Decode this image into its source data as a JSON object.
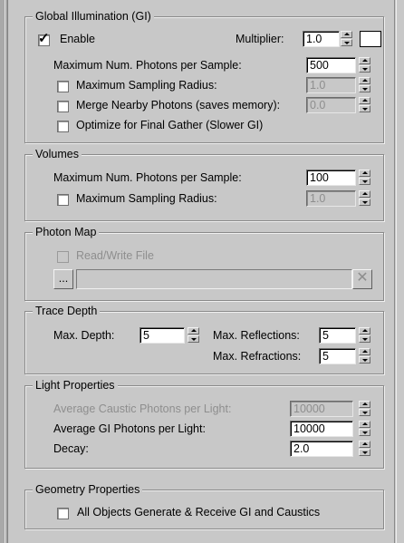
{
  "gi": {
    "title": "Global Illumination (GI)",
    "enable_label": "Enable",
    "enable_checked": true,
    "multiplier_label": "Multiplier:",
    "multiplier_value": "1.0",
    "multiplier_color": "#ffffff",
    "max_photons_label": "Maximum Num. Photons per Sample:",
    "max_photons_value": "500",
    "max_radius_label": "Maximum Sampling Radius:",
    "max_radius_value": "1.0",
    "merge_label": "Merge Nearby Photons (saves memory):",
    "merge_value": "0.0",
    "optimize_label": "Optimize for Final Gather (Slower GI)"
  },
  "volumes": {
    "title": "Volumes",
    "max_photons_label": "Maximum Num. Photons per Sample:",
    "max_photons_value": "100",
    "max_radius_label": "Maximum Sampling Radius:",
    "max_radius_value": "1.0"
  },
  "photon_map": {
    "title": "Photon Map",
    "rw_label": "Read/Write File",
    "browse_label": "...",
    "file_path": "",
    "clear_glyph": "✕"
  },
  "trace_depth": {
    "title": "Trace Depth",
    "max_depth_label": "Max. Depth:",
    "max_depth_value": "5",
    "reflections_label": "Max. Reflections:",
    "reflections_value": "5",
    "refractions_label": "Max. Refractions:",
    "refractions_value": "5"
  },
  "light": {
    "title": "Light Properties",
    "caustic_label": "Average Caustic Photons per Light:",
    "caustic_value": "10000",
    "gi_label": "Average GI Photons per Light:",
    "gi_value": "10000",
    "decay_label": "Decay:",
    "decay_value": "2.0"
  },
  "geometry": {
    "title": "Geometry Properties",
    "all_objects_label": "All Objects Generate & Receive GI and Caustics"
  }
}
